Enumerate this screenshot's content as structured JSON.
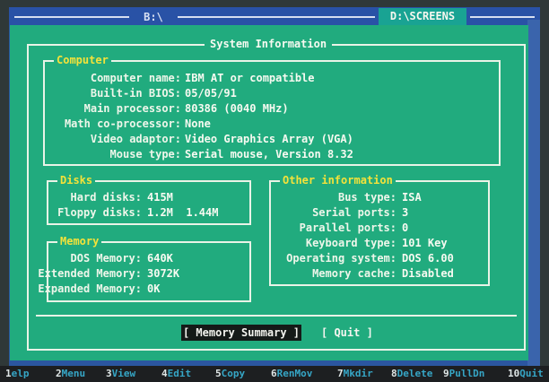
{
  "top_bar": {
    "left_path": "B:\\",
    "right_path": "D:\\SCREENS"
  },
  "dialog": {
    "title": "System Information",
    "computer": {
      "title": "Computer",
      "rows": [
        {
          "label": "Computer name:",
          "value": "IBM AT or compatible"
        },
        {
          "label": "Built-in BIOS:",
          "value": "05/05/91"
        },
        {
          "label": "Main processor:",
          "value": "80386 (0040 MHz)"
        },
        {
          "label": "Math co-processor:",
          "value": "None"
        },
        {
          "label": "Video adaptor:",
          "value": "Video Graphics Array (VGA)"
        },
        {
          "label": "Mouse type:",
          "value": "Serial mouse, Version 8.32"
        }
      ]
    },
    "disks": {
      "title": "Disks",
      "rows": [
        {
          "label": "Hard disks:",
          "value": "415M"
        },
        {
          "label": "Floppy disks:",
          "value": "1.2M  1.44M"
        }
      ]
    },
    "memory": {
      "title": "Memory",
      "rows": [
        {
          "label": "DOS Memory:",
          "value": "640K"
        },
        {
          "label": "Extended Memory:",
          "value": "3072K"
        },
        {
          "label": "Expanded Memory:",
          "value": "0K"
        }
      ]
    },
    "other": {
      "title": "Other information",
      "rows": [
        {
          "label": "Bus type:",
          "value": "ISA"
        },
        {
          "label": "Serial ports:",
          "value": "3"
        },
        {
          "label": "Parallel ports:",
          "value": "0"
        },
        {
          "label": "Keyboard type:",
          "value": "101 Key"
        },
        {
          "label": "Operating system:",
          "value": "DOS 6.00"
        },
        {
          "label": "Memory cache:",
          "value": "Disabled"
        }
      ]
    },
    "buttons": {
      "memory_summary": "[ Memory Summary ]",
      "quit": "[ Quit ]"
    }
  },
  "function_keys": [
    {
      "num": "1",
      "label": "elp"
    },
    {
      "num": "2",
      "label": "Menu"
    },
    {
      "num": "3",
      "label": "View"
    },
    {
      "num": "4",
      "label": "Edit"
    },
    {
      "num": "5",
      "label": "Copy"
    },
    {
      "num": "6",
      "label": "RenMov"
    },
    {
      "num": "7",
      "label": "Mkdir"
    },
    {
      "num": "8",
      "label": "Delete"
    },
    {
      "num": "9",
      "label": "PullDn"
    },
    {
      "num": "10",
      "label": "Quit"
    }
  ],
  "colors": {
    "dialog_bg": "#21ab7e",
    "panel_blue": "#2b56a0",
    "group_title": "#f4e23a",
    "fkey_label": "#36a6c6"
  }
}
